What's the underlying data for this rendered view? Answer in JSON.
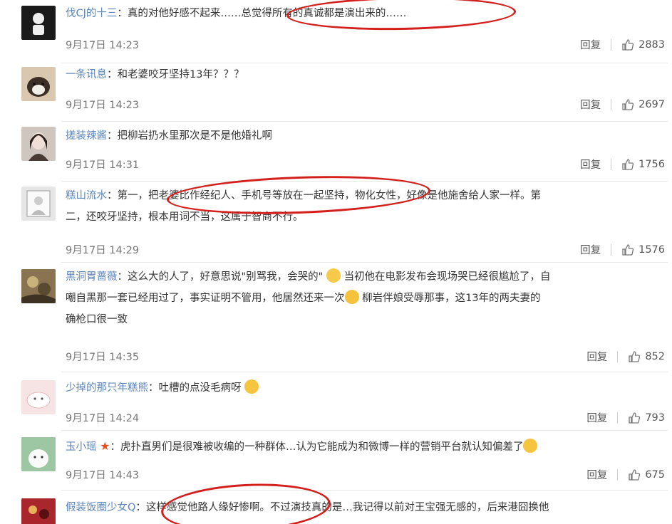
{
  "reply_label": "回复",
  "colors": {
    "username": "#5c85b8",
    "annotation": "#d4201c"
  },
  "comments": [
    {
      "user": "伐CJ的十三",
      "sep": "：",
      "lines": [
        "真的对他好感不起来……总觉得所有的真诚都是演出来的……"
      ],
      "time": "9月17日 14:23",
      "likes": "2883"
    },
    {
      "user": "一条讯息",
      "sep": "：",
      "lines": [
        "和老婆咬牙坚持13年？？？"
      ],
      "time": "9月17日 14:23",
      "likes": "2697"
    },
    {
      "user": "搓装辣酱",
      "sep": "：",
      "lines": [
        "把柳岩扔水里那次是不是他婚礼啊"
      ],
      "time": "9月17日 14:31",
      "likes": "1756"
    },
    {
      "user": "糕山流水",
      "sep": "：",
      "lines": [
        "第一，把老婆比作经纪人、手机号等放在一起坚持，物化女性，好像是他施舍给人家一样。第",
        "二，还咬牙坚持，根本用词不当，这属于智商不行。"
      ],
      "time": "9月17日 14:29",
      "likes": "1576"
    },
    {
      "user": "黑洞胃蔷薇",
      "sep": "：",
      "lines": [
        "这么大的人了，好意思说\"别骂我，会哭的\"",
        "当初他在电影发布会现场哭已经很尴尬了，自",
        "嘲自黑那一套已经用过了，事实证明不管用，他居然还来一次",
        "柳岩伴娘受辱那事，这13年的两夫妻的",
        "确枪口很一致"
      ],
      "time": "9月17日 14:35",
      "likes": "852"
    },
    {
      "user": "少掉的那只年糕熊",
      "sep": "：",
      "lines": [
        "吐槽的点没毛病呀"
      ],
      "time": "9月17日 14:24",
      "likes": "793"
    },
    {
      "user": "玉小瑶",
      "sep": "：",
      "lines": [
        "虎扑直男们是很难被收编的一种群体…认为它能成为和微博一样的营销平台就认知偏差了"
      ],
      "time": "9月17日 14:43",
      "likes": "675"
    },
    {
      "user": "假装饭圈少女Q",
      "sep": "：",
      "lines": [
        "这样感觉他路人缘好惨啊。不过演技真的是…我记得以前对王宝强无感的，后来港囧换他"
      ]
    }
  ]
}
